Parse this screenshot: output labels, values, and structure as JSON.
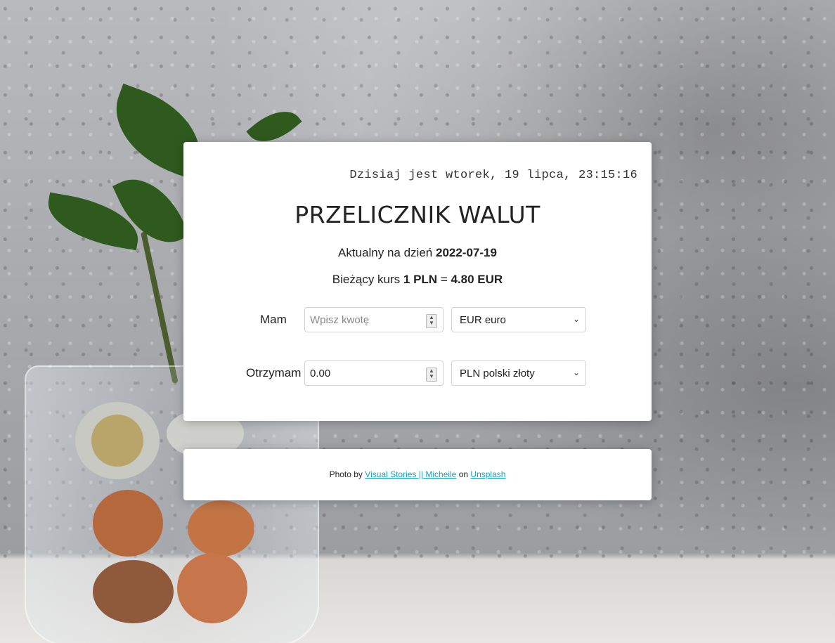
{
  "clock": "Dzisiaj jest wtorek, 19 lipca, 23:15:16",
  "title": "PRZELICZNIK WALUT",
  "updated": {
    "prefix": "Aktualny na dzień",
    "date": "2022-07-19"
  },
  "rate": {
    "prefix": "Bieżący kurs",
    "base": "1 PLN",
    "equals": "=",
    "quote": "4.80 EUR"
  },
  "have": {
    "label": "Mam",
    "amount_placeholder": "Wpisz kwotę",
    "currency": "EUR euro"
  },
  "get": {
    "label": "Otrzymam",
    "amount": "0.00",
    "currency": "PLN polski złoty"
  },
  "credit": {
    "prefix": "Photo by",
    "author": "Visual Stories || Micheile",
    "middle": "on",
    "site": "Unsplash"
  },
  "colors": {
    "link": "#17a2b8",
    "card_bg": "#ffffff"
  },
  "icons": {
    "spinner": "number-spinner-icon",
    "select_arrow": "chevron-down-icon"
  }
}
